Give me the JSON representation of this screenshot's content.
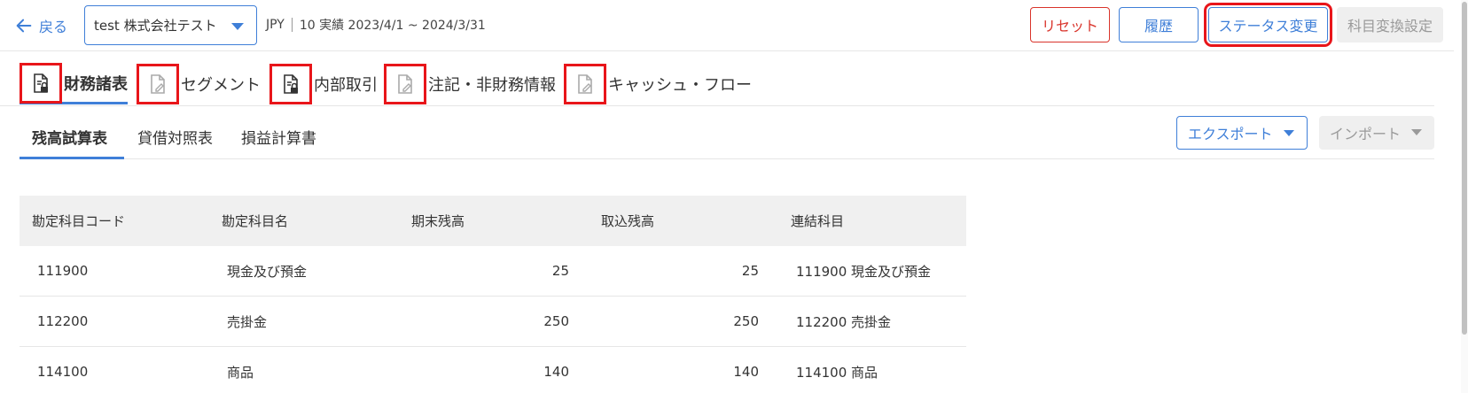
{
  "header": {
    "back_label": "戻る",
    "company": "test 株式会社テスト",
    "currency": "JPY",
    "period": "10 実績 2023/4/1 ~ 2024/3/31",
    "buttons": {
      "reset": "リセット",
      "history": "履歴",
      "status_change": "ステータス変更",
      "account_conversion": "科目変換設定"
    }
  },
  "doc_tabs": [
    {
      "label": "財務諸表",
      "icon": "document-lock-icon",
      "active": true
    },
    {
      "label": "セグメント",
      "icon": "document-edit-icon",
      "active": false
    },
    {
      "label": "内部取引",
      "icon": "document-lock-icon",
      "active": false
    },
    {
      "label": "注記・非財務情報",
      "icon": "document-edit-icon",
      "active": false
    },
    {
      "label": "キャッシュ・フロー",
      "icon": "document-edit-icon",
      "active": false
    }
  ],
  "sub_tabs": [
    {
      "label": "残高試算表",
      "active": true
    },
    {
      "label": "貸借対照表",
      "active": false
    },
    {
      "label": "損益計算書",
      "active": false
    }
  ],
  "actions": {
    "export": "エクスポート",
    "import": "インポート"
  },
  "table": {
    "headers": [
      "勘定科目コード",
      "勘定科目名",
      "期末残高",
      "取込残高",
      "連結科目"
    ],
    "rows": [
      [
        "111900",
        "現金及び預金",
        "25",
        "25",
        "111900 現金及び預金"
      ],
      [
        "112200",
        "売掛金",
        "250",
        "250",
        "112200 売掛金"
      ],
      [
        "114100",
        "商品",
        "140",
        "140",
        "114100 商品"
      ]
    ]
  },
  "colors": {
    "accent": "#3f7fd8",
    "danger": "#d9342b",
    "highlight": "#e8151a",
    "disabled_bg": "#efefef"
  }
}
